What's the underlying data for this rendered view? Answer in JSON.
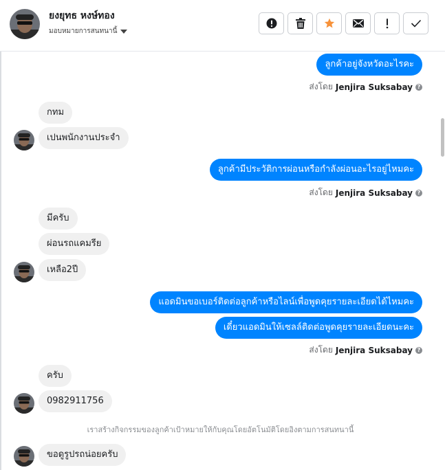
{
  "header": {
    "contact_name": "ยงยุทธ หงษ์ทอง",
    "assign_label": "มอบหมายการสนทนานี้",
    "toolbar": [
      {
        "icon": "alert-circle-icon"
      },
      {
        "icon": "trash-icon"
      },
      {
        "icon": "star-icon"
      },
      {
        "icon": "mail-icon"
      },
      {
        "icon": "exclamation-icon"
      },
      {
        "icon": "check-icon"
      }
    ],
    "star_color": "#f7923a"
  },
  "colors": {
    "outgoing_bubble": "#0084ff",
    "incoming_bubble": "#f0f0f0",
    "meta_text": "#65676b"
  },
  "messages": [
    {
      "dir": "out",
      "text": "ลูกค้าอยู่จังหวัดอะไรคะ"
    },
    {
      "sent_prefix": "ส่งโดย",
      "sent_by": "Jenjira Suksabay"
    },
    {
      "dir": "in",
      "text": "กทม"
    },
    {
      "dir": "in",
      "text": "เปนพนักงานประจำ"
    },
    {
      "dir": "out",
      "text": "ลูกค้ามีประวัติการผ่อนหรือกำลังผ่อนอะไรอยู่ไหมคะ"
    },
    {
      "sent_prefix": "ส่งโดย",
      "sent_by": "Jenjira Suksabay"
    },
    {
      "dir": "in",
      "text": "มีครับ"
    },
    {
      "dir": "in",
      "text": "ผ่อนรถแคมรีย"
    },
    {
      "dir": "in",
      "text": "เหลือ2ปี"
    },
    {
      "dir": "out",
      "text": "แอดมินขอเบอร์ติดต่อลูกค้าหรือไลน์เพื่อพูดคุยรายละเอียดได้ไหมคะ"
    },
    {
      "dir": "out",
      "text": "เดี๋ยวแอดมินให้เซลล์ติดต่อพูดคุยรายละเอียดนะคะ"
    },
    {
      "sent_prefix": "ส่งโดย",
      "sent_by": "Jenjira Suksabay"
    },
    {
      "dir": "in",
      "text": "ครับ"
    },
    {
      "dir": "in",
      "text": "0982911756"
    },
    {
      "system": "เราสร้างกิจกรรมของลูกค้าเป้าหมายให้กับคุณโดยอัตโนมัติโดยอิงตามการสนทนานี้"
    },
    {
      "dir": "in",
      "text": "ขอดูรูปรถน่อยครับ"
    }
  ]
}
